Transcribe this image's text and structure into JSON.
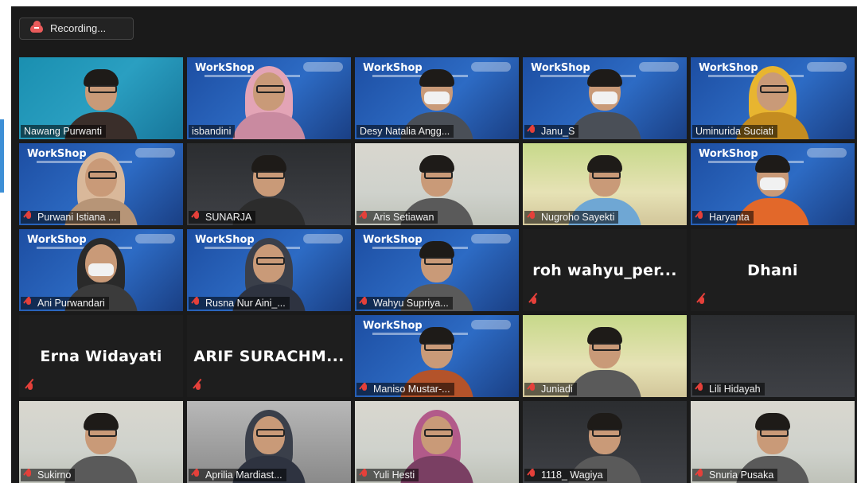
{
  "toolbar": {
    "recording_label": "Recording..."
  },
  "tiles": [
    {
      "name": "Nawang Purwanti",
      "muted": false,
      "active": true,
      "bg": "teal",
      "workshop": false,
      "kind": "hair"
    },
    {
      "name": "isbandini",
      "muted": false,
      "bg": "blue",
      "workshop": true,
      "kind": "hijab"
    },
    {
      "name": "Desy Natalia Angg...",
      "muted": false,
      "bg": "blue",
      "workshop": true,
      "kind": "mask"
    },
    {
      "name": "Janu_S",
      "muted": true,
      "bg": "blue",
      "workshop": true,
      "kind": "mask"
    },
    {
      "name": "Uminurida Suciati",
      "muted": false,
      "bg": "blue",
      "workshop": true,
      "kind": "hijab-yellow"
    },
    {
      "name": "Purwani Istiana ...",
      "muted": true,
      "bg": "blue",
      "workshop": true,
      "kind": "hijab-beige"
    },
    {
      "name": "SUNARJA",
      "muted": true,
      "bg": "dark",
      "workshop": false,
      "kind": "cap"
    },
    {
      "name": "Aris Setiawan",
      "muted": true,
      "bg": "room",
      "workshop": false,
      "kind": "man"
    },
    {
      "name": "Nugroho Sayekti",
      "muted": true,
      "bg": "green",
      "workshop": false,
      "kind": "man-blue"
    },
    {
      "name": "Haryanta",
      "muted": true,
      "bg": "blue",
      "workshop": true,
      "kind": "mask-orange"
    },
    {
      "name": "Ani Purwandari",
      "muted": true,
      "bg": "blue",
      "workshop": true,
      "kind": "hijab-gray"
    },
    {
      "name": "Rusna Nur Aini_...",
      "muted": true,
      "bg": "blue",
      "workshop": true,
      "kind": "hijab-dark"
    },
    {
      "name": "Wahyu Supriya...",
      "muted": true,
      "bg": "blue",
      "workshop": true,
      "kind": "man"
    },
    {
      "name": "roh wahyu_per...",
      "muted": true,
      "video_off": true
    },
    {
      "name": "Dhani",
      "muted": true,
      "video_off": true
    },
    {
      "name": "Erna Widayati",
      "muted": true,
      "video_off": true
    },
    {
      "name": "ARIF SURACHM...",
      "muted": true,
      "video_off": true
    },
    {
      "name": "Maniso Mustar-...",
      "muted": true,
      "bg": "blue",
      "workshop": true,
      "kind": "man-batik"
    },
    {
      "name": "Juniadi",
      "muted": true,
      "bg": "green",
      "workshop": false,
      "kind": "man"
    },
    {
      "name": "Lili Hidayah",
      "muted": true,
      "bg": "dark",
      "workshop": false,
      "kind": "none"
    },
    {
      "name": "Sukirno",
      "muted": true,
      "bg": "room",
      "workshop": false,
      "kind": "man"
    },
    {
      "name": "Aprilia Mardiast...",
      "muted": true,
      "bg": "gray",
      "workshop": false,
      "kind": "hijab-dark"
    },
    {
      "name": "Yuli Hesti",
      "muted": true,
      "bg": "room",
      "workshop": false,
      "kind": "hijab-purple"
    },
    {
      "name": "1118_ Wagiya",
      "muted": true,
      "bg": "dark",
      "workshop": false,
      "kind": "man"
    },
    {
      "name": "Snuria Pusaka",
      "muted": true,
      "bg": "room",
      "workshop": false,
      "kind": "man"
    }
  ],
  "workshop_banner": "WorkShop"
}
